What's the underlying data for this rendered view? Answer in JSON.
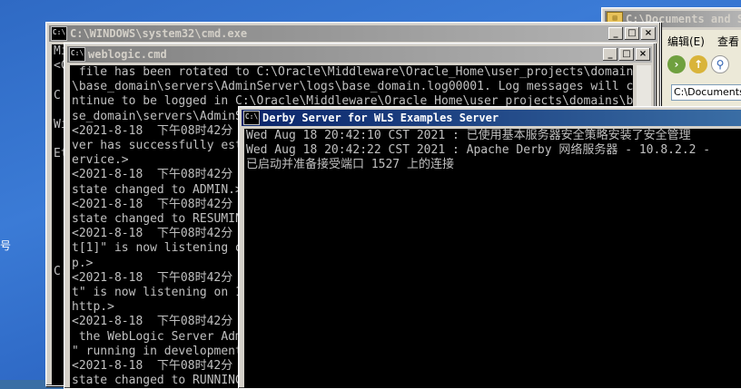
{
  "desktop": {
    "glyph": "号"
  },
  "explorer": {
    "title": "C:\\Documents and Se",
    "menu": [
      "编辑(E)",
      "查看"
    ],
    "address": "C:\\Documents",
    "buttons": [
      "back-icon",
      "up-icon",
      "search-icon"
    ]
  },
  "cmd_window": {
    "title": "C:\\WINDOWS\\system32\\cmd.exe",
    "icon_label": "C:\\",
    "text": "Mi\n<C\n\nC:\n\nWi\n\nEt\n\n\n\n\n\n\n\nC:"
  },
  "weblogic_window": {
    "title": "weblogic.cmd",
    "icon_label": "C:\\",
    "text": " file has been rotated to C:\\Oracle\\Middleware\\Oracle_Home\\user_projects\\domains\n\\base_domain\\servers\\AdminServer\\logs\\base_domain.log00001. Log messages will co\nntinue to be logged in C:\\Oracle\\Middleware\\Oracle_Home\\user_projects\\domains\\ba\nse_domain\\servers\\AdminS\n<2021-8-18  下午08时42分\nver has successfully est\nervice.>\n<2021-8-18  下午08时42分\nstate changed to ADMIN.>\n<2021-8-18  下午08时42分\nstate changed to RESUMIN\n<2021-8-18  下午08时42分\nt[1]\" is now listening o\np.>\n<2021-8-18  下午08时42分\nt\" is now listening on 1\nhttp.>\n<2021-8-18  下午08时42分\n the WebLogic Server Adm\n\" running in development\n<2021-8-18  下午08时42分\nstate changed to RUNNING"
  },
  "derby_window": {
    "title": "Derby Server for WLS Examples Server",
    "icon_label": "C:\\",
    "text": "Wed Aug 18 20:42:10 CST 2021 : 已使用基本服务器安全策略安装了安全管理\nWed Aug 18 20:42:22 CST 2021 : Apache Derby 网络服务器 - 10.8.2.2 -\n已启动并准备接受端口 1527 上的连接"
  },
  "controls": {
    "minimize": "_",
    "maximize": "□",
    "close": "×"
  }
}
